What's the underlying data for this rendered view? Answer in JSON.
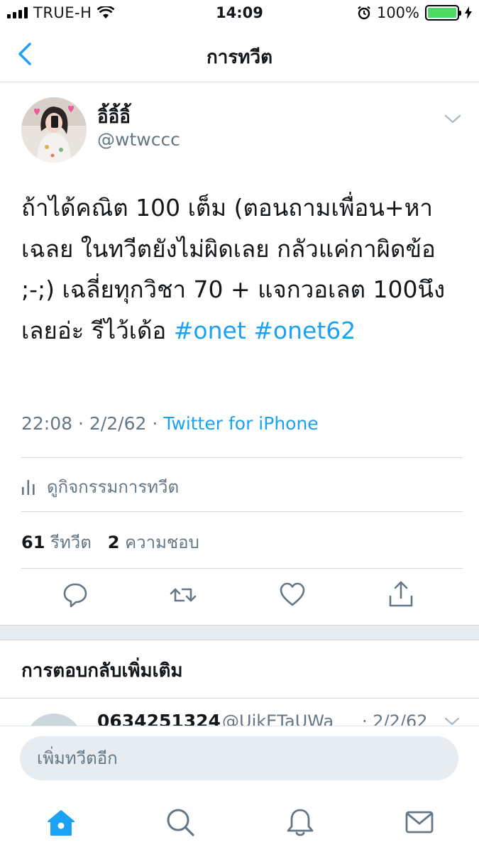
{
  "status_bar": {
    "carrier": "TRUE-H",
    "time": "14:09",
    "battery_percent": "100%",
    "battery_level": 1.0,
    "battery_color": "#4cd964"
  },
  "nav": {
    "title": "การทวีต",
    "back_icon": "chevron-left-icon"
  },
  "tweet": {
    "display_name": "อิ้อิ้อิ้",
    "username": "@wtwccc",
    "text_plain": "ถ้าได้คณิต 100 เต็ม (ตอนถามเพื่อน+หาเฉลย ในทวีตยังไม่ผิดเลย กลัวแค่กาผิดข้อ ;-;) เฉลี่ยทุกวิชา 70 + แจกวอเลต 100นึงเลยอ่ะ รีไว้เด้อ",
    "hashtag_1": "#onet",
    "hashtag_2": "#onet62",
    "time": "22:08",
    "date": "2/2/62",
    "separator": "·",
    "source": "Twitter for iPhone"
  },
  "activity": {
    "label": "ดูกิจกรรมการทวีต",
    "icon": "bar-chart-icon"
  },
  "stats": {
    "retweets_count": "61",
    "retweets_label": "รีทวีต",
    "likes_count": "2",
    "likes_label": "ความชอบ"
  },
  "actions": [
    "reply-icon",
    "retweet-icon",
    "like-icon",
    "share-icon"
  ],
  "more_replies": {
    "title": "การตอบกลับเพิ่มเติม"
  },
  "reply_preview": {
    "name": "0634251324",
    "handle": "@UjkETaUWa",
    "date": "· 2/2/62"
  },
  "compose": {
    "placeholder": "เพิ่มทวีตอีก"
  },
  "tabbar": [
    "home-icon",
    "search-icon",
    "notifications-icon",
    "messages-icon"
  ],
  "colors": {
    "accent": "#1da1f2",
    "secondary_text": "#657786",
    "divider": "#d6d9dc"
  }
}
